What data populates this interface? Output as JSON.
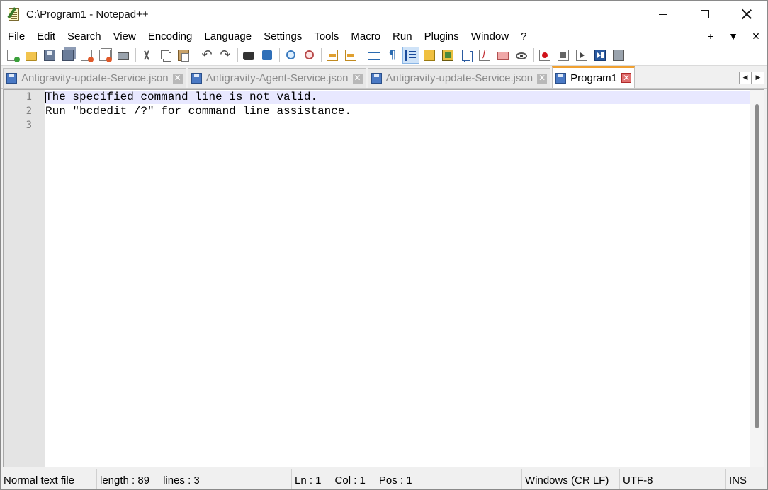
{
  "window": {
    "title": "C:\\Program1 - Notepad++",
    "minimize_icon": "minimize-icon",
    "maximize_icon": "maximize-icon",
    "close_icon": "close-icon"
  },
  "menu": {
    "items": [
      "File",
      "Edit",
      "Search",
      "View",
      "Encoding",
      "Language",
      "Settings",
      "Tools",
      "Macro",
      "Run",
      "Plugins",
      "Window",
      "?"
    ],
    "right": {
      "add": "+",
      "dropdown": "▼",
      "close": "✕"
    }
  },
  "toolbar": {
    "icons": [
      "new-file",
      "open-file",
      "save",
      "save-all",
      "close",
      "close-all",
      "print",
      "cut",
      "copy",
      "paste",
      "undo",
      "redo",
      "find",
      "replace",
      "zoom-in",
      "zoom-out",
      "sync-vertical",
      "sync-horizontal",
      "word-wrap",
      "show-all-characters",
      "indent-guide",
      "user-defined-language",
      "document-map",
      "document-list",
      "function-list",
      "folder-as-workspace",
      "monitoring",
      "macro-record",
      "macro-stop",
      "macro-play",
      "macro-run-multiple",
      "macro-save"
    ],
    "undo_glyph": "↶",
    "redo_glyph": "↷",
    "pilcrow": "¶"
  },
  "tabs": [
    {
      "label": "Antigravity-update-Service.json",
      "active": false,
      "close": "✕"
    },
    {
      "label": "Antigravity-Agent-Service.json",
      "active": false,
      "close": "✕"
    },
    {
      "label": "Antigravity-update-Service.json",
      "active": false,
      "close": "✕"
    },
    {
      "label": "Program1",
      "active": true,
      "close": "✕"
    }
  ],
  "tab_scroll": {
    "left": "◀",
    "right": "▶"
  },
  "editor": {
    "line_numbers": [
      "1",
      "2",
      "3"
    ],
    "lines": [
      "The specified command line is not valid.",
      "Run \"bcdedit /?\" for command line assistance.",
      ""
    ]
  },
  "status": {
    "file_type": "Normal text file",
    "length": "length : 89",
    "lines": "lines : 3",
    "ln": "Ln : 1",
    "col": "Col : 1",
    "pos": "Pos : 1",
    "eol": "Windows (CR LF)",
    "encoding": "UTF-8",
    "mode": "INS"
  }
}
